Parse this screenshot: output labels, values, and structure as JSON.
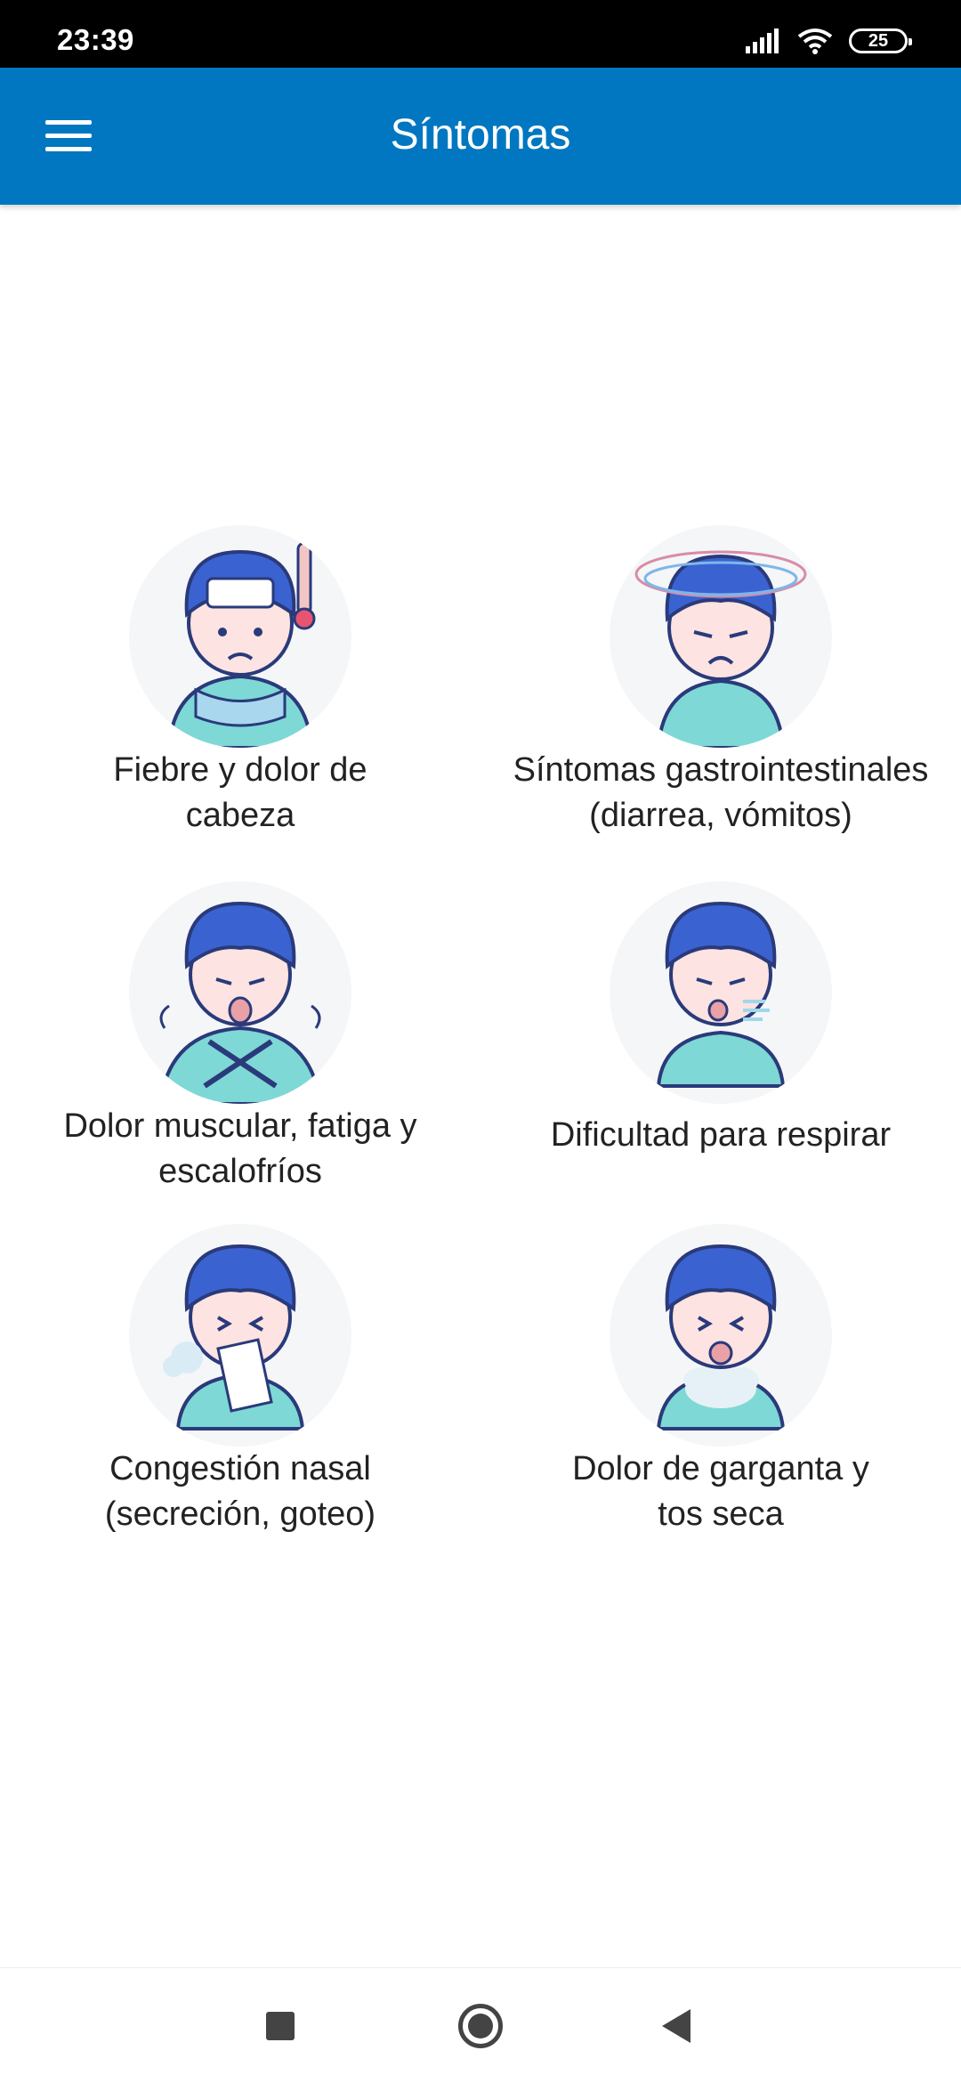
{
  "status_bar": {
    "time": "23:39",
    "battery_level": "25",
    "icons": [
      "signal-icon",
      "wifi-icon",
      "battery-icon"
    ]
  },
  "app_bar": {
    "title": "Síntomas",
    "menu_icon": "hamburger-icon",
    "color": "#0077c0"
  },
  "symptoms": [
    {
      "label": "Fiebre y dolor de\ncabeza",
      "icon": "fever-headache-illustration"
    },
    {
      "label": "Síntomas gastrointestinales\n(diarrea, vómitos)",
      "icon": "dizzy-illustration"
    },
    {
      "label": "Dolor muscular, fatiga y\nescalofríos",
      "icon": "chills-illustration"
    },
    {
      "label": "Dificultad para respirar",
      "icon": "breathing-difficulty-illustration"
    },
    {
      "label": "Congestión nasal\n(secreción, goteo)",
      "icon": "runny-nose-illustration"
    },
    {
      "label": "Dolor de garganta y\ntos seca",
      "icon": "cough-illustration"
    }
  ],
  "nav_bar": {
    "icons": [
      "recents-icon",
      "home-icon",
      "back-icon"
    ]
  },
  "colors": {
    "hair": "#3a63d1",
    "skin": "#fde3e1",
    "outline": "#2a3a7a",
    "shirt": "#7ed8d6"
  }
}
